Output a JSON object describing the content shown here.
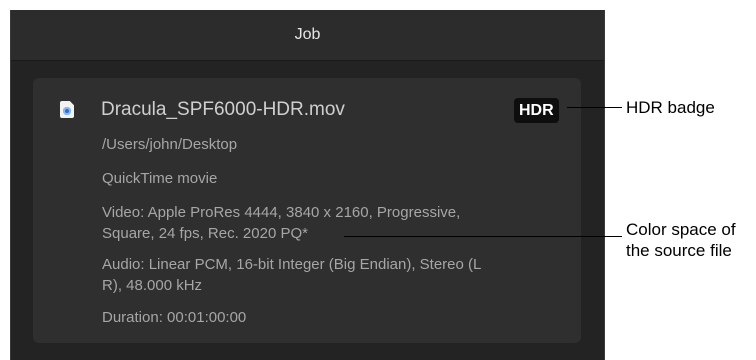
{
  "window": {
    "title": "Job"
  },
  "file": {
    "name": "Dracula_SPF6000-HDR.mov",
    "badge": "HDR",
    "path": "/Users/john/Desktop",
    "type": "QuickTime movie",
    "video_line1": "Video: Apple ProRes 4444, 3840 x 2160, Progressive,",
    "video_line2": "Square, 24 fps, Rec. 2020 PQ*",
    "audio_line1": "Audio: Linear PCM, 16-bit Integer (Big Endian), Stereo (L",
    "audio_line2": "R), 48.000 kHz",
    "duration": "Duration: 00:01:00:00"
  },
  "callouts": {
    "hdr_badge": "HDR badge",
    "color_space_line1": "Color space of",
    "color_space_line2": "the source file"
  },
  "icons": {
    "file": "quicktime-file-icon"
  }
}
